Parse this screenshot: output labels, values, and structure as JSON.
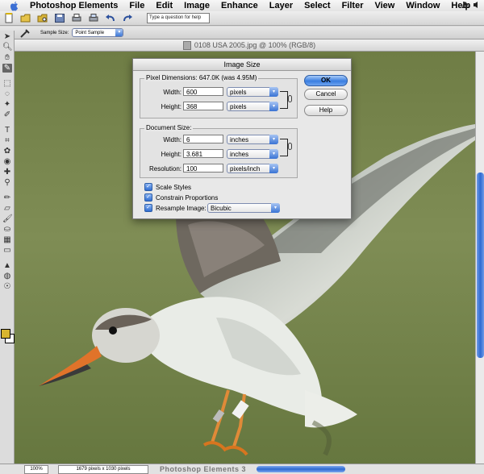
{
  "menubar": {
    "app_name": "Photoshop Elements",
    "items": [
      "File",
      "Edit",
      "Image",
      "Enhance",
      "Layer",
      "Select",
      "Filter",
      "View",
      "Window",
      "Help"
    ]
  },
  "toolbar": {
    "help_placeholder": "Type a question for help"
  },
  "options_bar": {
    "sample_size_label": "Sample Size:",
    "sample_size_value": "Point Sample"
  },
  "document": {
    "title": "0108 USA 2005.jpg @ 100% (RGB/8)"
  },
  "dialog": {
    "title": "Image Size",
    "pixel_dimensions_label": "Pixel Dimensions:",
    "pixel_dimensions_value": "647.0K (was 4.95M)",
    "pixel_width_label": "Width:",
    "pixel_width_value": "600",
    "pixel_width_unit": "pixels",
    "pixel_height_label": "Height:",
    "pixel_height_value": "368",
    "pixel_height_unit": "pixels",
    "document_size_label": "Document Size:",
    "doc_width_label": "Width:",
    "doc_width_value": "6",
    "doc_width_unit": "inches",
    "doc_height_label": "Height:",
    "doc_height_value": "3.681",
    "doc_height_unit": "inches",
    "resolution_label": "Resolution:",
    "resolution_value": "100",
    "resolution_unit": "pixels/inch",
    "scale_styles_label": "Scale Styles",
    "constrain_label": "Constrain Proportions",
    "resample_label": "Resample Image:",
    "resample_method": "Bicubic",
    "ok_label": "OK",
    "cancel_label": "Cancel",
    "help_label": "Help"
  },
  "statusbar": {
    "zoom": "100%",
    "doc_info": "1679 pixels x 1030 pixels",
    "app_title": "Photoshop Elements 3"
  },
  "colors": {
    "foreground": "#d8b52f",
    "background": "#ffffff",
    "accent": "#3a7ee0"
  }
}
